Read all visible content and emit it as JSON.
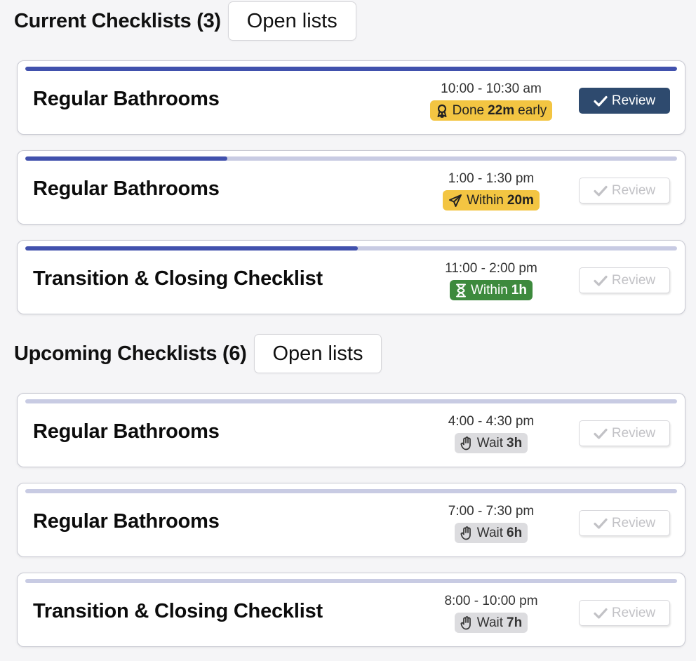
{
  "current": {
    "title": "Current Checklists (3)",
    "open_label": "Open lists"
  },
  "upcoming": {
    "title": "Upcoming Checklists (6)",
    "open_label": "Open lists"
  },
  "review_label": "Review",
  "colors": {
    "progress_fill": "#4151ad",
    "progress_track": "#c8cbe3",
    "badge_yellow": "#f3c542",
    "badge_green": "#3d8a3d",
    "badge_gray": "#dcdcdf",
    "review_active": "#2e4a6e"
  },
  "cards": [
    {
      "title": "Regular Bathrooms",
      "time": "10:00 - 10:30 am",
      "badge_label": "Done",
      "badge_value": "22m",
      "badge_suffix": "early",
      "badge_icon": "award-icon",
      "badge_color": "yellow",
      "progress": 1.0,
      "review_active": true
    },
    {
      "title": "Regular Bathrooms",
      "time": "1:00 - 1:30 pm",
      "badge_label": "Within",
      "badge_value": "20m",
      "badge_suffix": "",
      "badge_icon": "paper-plane-icon",
      "badge_color": "yellow",
      "progress": 0.31,
      "review_active": false
    },
    {
      "title": "Transition & Closing Checklist",
      "time": "11:00 - 2:00 pm",
      "badge_label": "Within",
      "badge_value": "1h",
      "badge_suffix": "",
      "badge_icon": "hourglass-icon",
      "badge_color": "green",
      "progress": 0.51,
      "review_active": false
    },
    {
      "title": "Regular Bathrooms",
      "time": "4:00 - 4:30 pm",
      "badge_label": "Wait",
      "badge_value": "3h",
      "badge_suffix": "",
      "badge_icon": "hand-icon",
      "badge_color": "gray",
      "progress": 0,
      "review_active": false
    },
    {
      "title": "Regular Bathrooms",
      "time": "7:00 - 7:30 pm",
      "badge_label": "Wait",
      "badge_value": "6h",
      "badge_suffix": "",
      "badge_icon": "hand-icon",
      "badge_color": "gray",
      "progress": 0,
      "review_active": false
    },
    {
      "title": "Transition & Closing Checklist",
      "time": "8:00 - 10:00 pm",
      "badge_label": "Wait",
      "badge_value": "7h",
      "badge_suffix": "",
      "badge_icon": "hand-icon",
      "badge_color": "gray",
      "progress": 0,
      "review_active": false
    }
  ]
}
